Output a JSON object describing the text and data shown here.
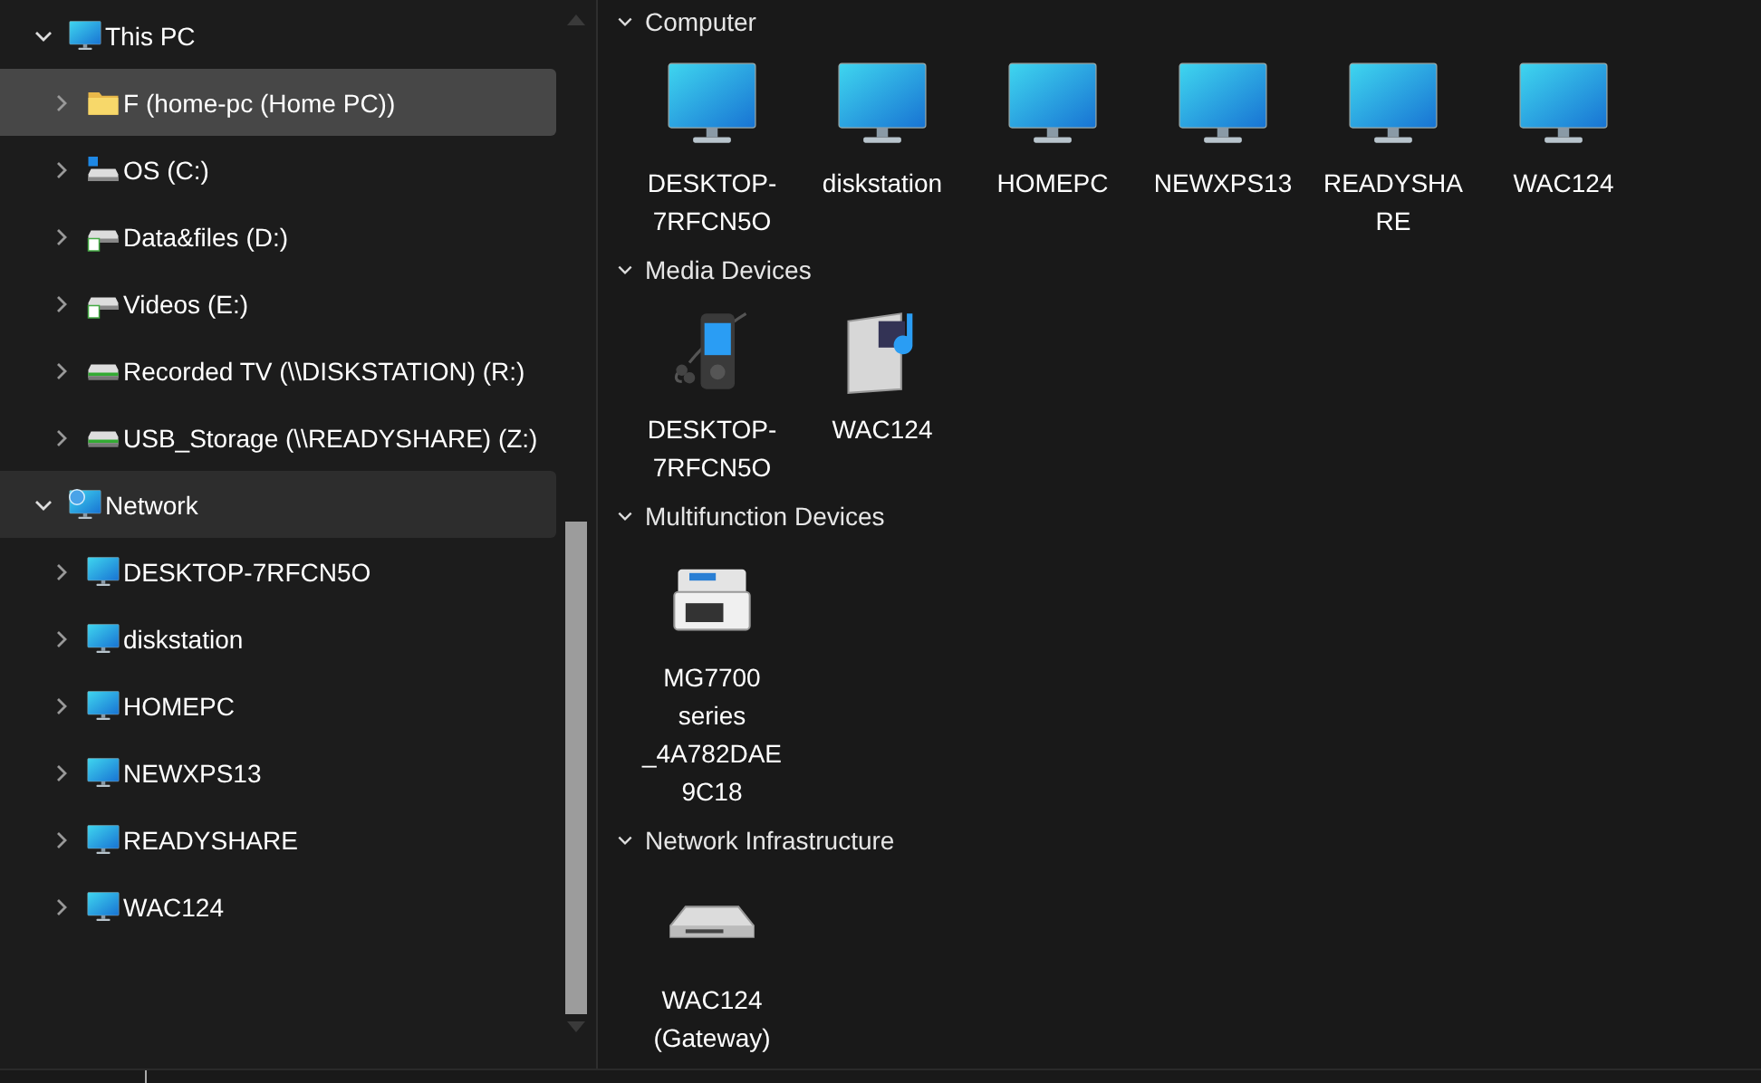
{
  "navigation_pane": {
    "items": [
      {
        "label": "This PC",
        "kind": "computer",
        "expanded": true,
        "selected": false,
        "highlighted": false,
        "children": [
          {
            "label": "F (home-pc (Home PC))",
            "kind": "folder",
            "expanded": false,
            "selected": true,
            "highlighted": false
          },
          {
            "label": "OS (C:)",
            "kind": "os-drive",
            "expanded": false,
            "selected": false,
            "highlighted": false
          },
          {
            "label": "Data&files (D:)",
            "kind": "drive",
            "expanded": false,
            "selected": false,
            "highlighted": false
          },
          {
            "label": "Videos (E:)",
            "kind": "drive",
            "expanded": false,
            "selected": false,
            "highlighted": false
          },
          {
            "label": "Recorded TV (\\\\DISKSTATION) (R:)",
            "kind": "network-drive",
            "expanded": false,
            "selected": false,
            "highlighted": false
          },
          {
            "label": "USB_Storage (\\\\READYSHARE) (Z:)",
            "kind": "network-drive",
            "expanded": false,
            "selected": false,
            "highlighted": false
          }
        ]
      },
      {
        "label": "Network",
        "kind": "network",
        "expanded": true,
        "selected": false,
        "highlighted": true,
        "children": [
          {
            "label": "DESKTOP-7RFCN5O",
            "kind": "computer",
            "expanded": false,
            "selected": false,
            "highlighted": false
          },
          {
            "label": "diskstation",
            "kind": "computer",
            "expanded": false,
            "selected": false,
            "highlighted": false
          },
          {
            "label": "HOMEPC",
            "kind": "computer",
            "expanded": false,
            "selected": false,
            "highlighted": false
          },
          {
            "label": "NEWXPS13",
            "kind": "computer",
            "expanded": false,
            "selected": false,
            "highlighted": false
          },
          {
            "label": "READYSHARE",
            "kind": "computer",
            "expanded": false,
            "selected": false,
            "highlighted": false
          },
          {
            "label": "WAC124",
            "kind": "computer",
            "expanded": false,
            "selected": false,
            "highlighted": false
          }
        ]
      }
    ]
  },
  "content": {
    "groups": [
      {
        "title": "Computer",
        "expanded": true,
        "items": [
          {
            "label": "DESKTOP-7RFCN5O",
            "kind": "computer"
          },
          {
            "label": "diskstation",
            "kind": "computer"
          },
          {
            "label": "HOMEPC",
            "kind": "computer"
          },
          {
            "label": "NEWXPS13",
            "kind": "computer"
          },
          {
            "label": "READYSHARE",
            "kind": "computer"
          },
          {
            "label": "WAC124",
            "kind": "computer"
          }
        ]
      },
      {
        "title": "Media Devices",
        "expanded": true,
        "items": [
          {
            "label": "DESKTOP-7RFCN5O",
            "kind": "media-player"
          },
          {
            "label": "WAC124",
            "kind": "media-server"
          }
        ]
      },
      {
        "title": "Multifunction Devices",
        "expanded": true,
        "items": [
          {
            "label": "MG7700 series _4A782DAE9C18",
            "kind": "printer"
          }
        ]
      },
      {
        "title": "Network Infrastructure",
        "expanded": true,
        "items": [
          {
            "label": "WAC124 (Gateway)",
            "kind": "router"
          }
        ]
      }
    ]
  }
}
